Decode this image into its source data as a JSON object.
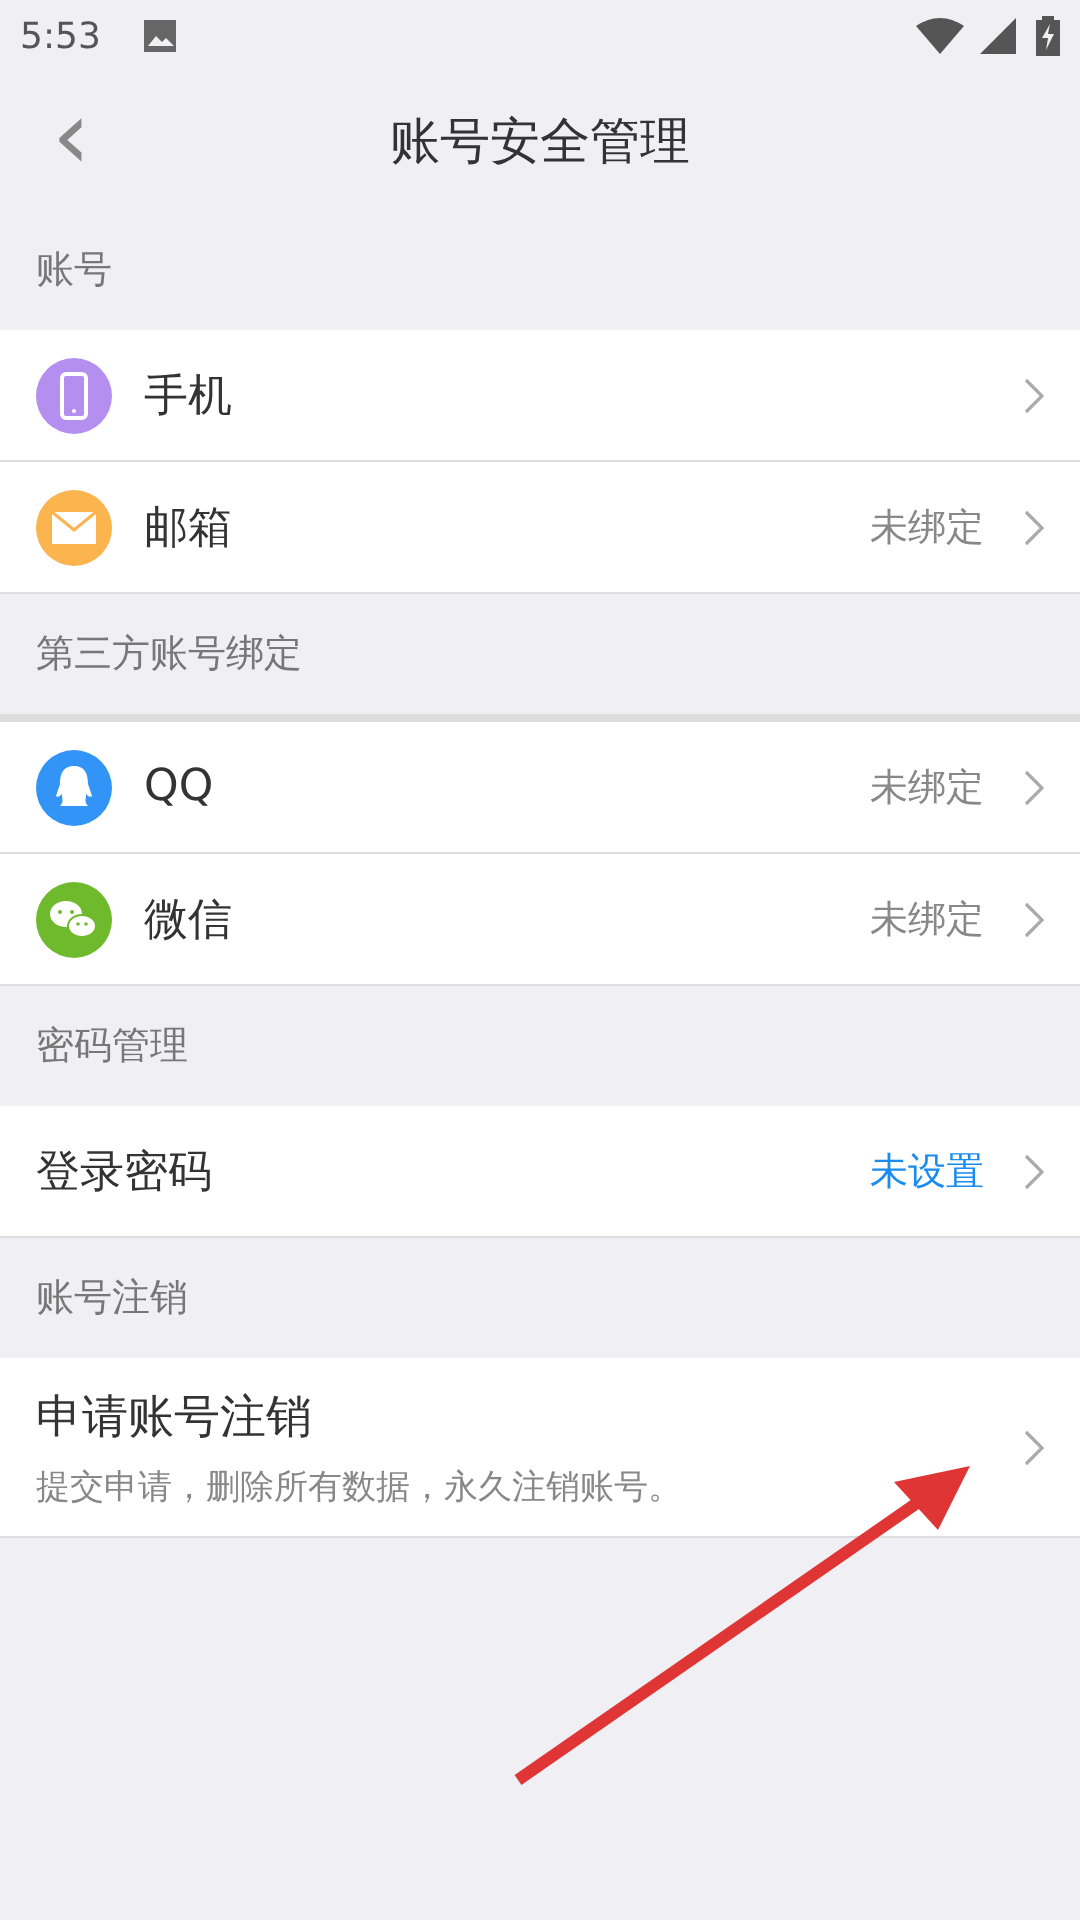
{
  "status_bar": {
    "time": "5:53"
  },
  "header": {
    "back": "‹",
    "title": "账号安全管理"
  },
  "sections": [
    {
      "title": "账号",
      "thick_divider": false,
      "rows": [
        {
          "kind": "phone",
          "color": "#b48ff0",
          "label": "手机"
        },
        {
          "kind": "mail",
          "color": "#fbb44e",
          "label": "邮箱",
          "status": {
            "text": "未绑定",
            "emphasized": false
          }
        }
      ]
    },
    {
      "title": "第三方账号绑定",
      "thick_divider": true,
      "rows": [
        {
          "kind": "qq",
          "color": "#3394f7",
          "label": "QQ",
          "status": {
            "text": "未绑定",
            "emphasized": false
          }
        },
        {
          "kind": "wechat",
          "color": "#6fba2c",
          "label": "微信",
          "status": {
            "text": "未绑定",
            "emphasized": false
          }
        }
      ]
    },
    {
      "title": "密码管理",
      "thick_divider": false,
      "rows": [
        {
          "kind": "plain",
          "label": "登录密码",
          "status": {
            "text": "未设置",
            "emphasized": true
          }
        }
      ]
    },
    {
      "title": "账号注销",
      "thick_divider": false,
      "rows": [
        {
          "kind": "detail",
          "label": "申请账号注销",
          "description": "提交申请，删除所有数据，永久注销账号。"
        }
      ]
    }
  ]
}
